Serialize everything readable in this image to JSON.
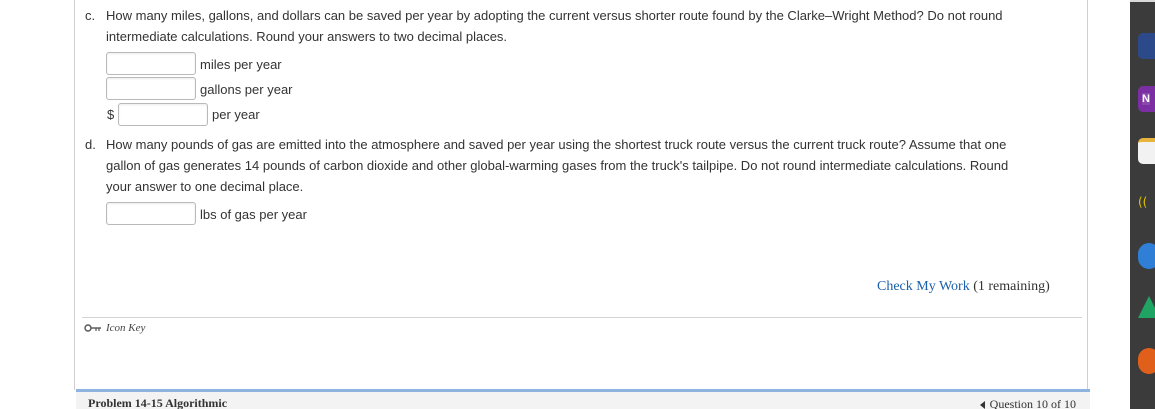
{
  "question_c": {
    "letter": "c.",
    "line1": "How many miles, gallons, and dollars can be saved per year by adopting the current versus shorter route found by the Clarke–Wright Method? Do not round",
    "line2": "intermediate calculations. Round your answers to two decimal places.",
    "fields": [
      {
        "prefix": "",
        "value": "",
        "unit": "miles per year"
      },
      {
        "prefix": "",
        "value": "",
        "unit": "gallons per year"
      },
      {
        "prefix": "$",
        "value": "",
        "unit": "per year"
      }
    ]
  },
  "question_d": {
    "letter": "d.",
    "line1": "How many pounds of gas are emitted into the atmosphere and saved per year using the shortest truck route versus the current truck route? Assume that one",
    "line2": "gallon of gas generates 14 pounds of carbon dioxide and other global-warming gases from the truck's tailpipe. Do not round intermediate calculations. Round",
    "line3": "your answer to one decimal place.",
    "field": {
      "value": "",
      "unit": "lbs of gas per year"
    }
  },
  "check_work": {
    "link_label": "Check My Work",
    "remaining": "(1 remaining)"
  },
  "icon_key": {
    "label": "Icon Key",
    "icon": "key-icon"
  },
  "footer": {
    "problem_title": "Problem 14-15 Algorithmic",
    "question_position": "Question 10 of 10"
  },
  "dock": {
    "items": [
      {
        "icon": "book-app-icon",
        "color": "#2c4a8a"
      },
      {
        "icon": "onenote-app-icon",
        "color": "#7b2fa3",
        "letter": "N"
      },
      {
        "icon": "notes-app-icon",
        "color": "#f2f2f2"
      },
      {
        "icon": "wifi-app-icon",
        "color": "#3b3b3b"
      },
      {
        "icon": "cloud-app-icon",
        "color": "#2f7fd6"
      },
      {
        "icon": "drive-app-icon",
        "color": "#1fa463"
      },
      {
        "icon": "gauge-app-icon",
        "color": "#e0601b"
      }
    ]
  }
}
